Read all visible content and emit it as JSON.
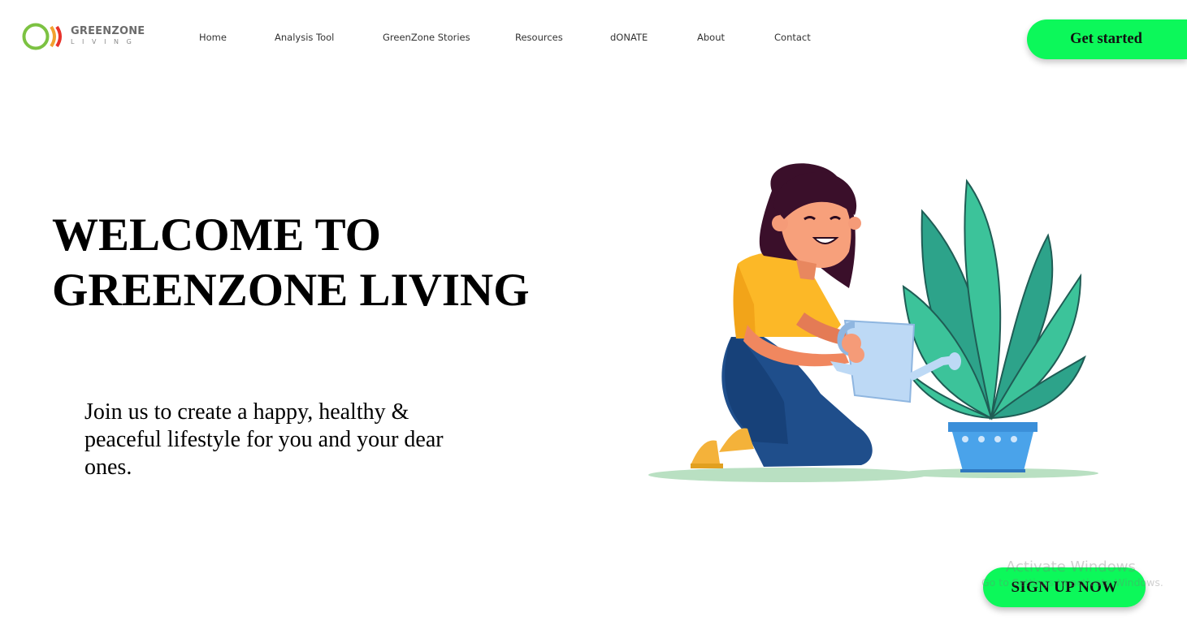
{
  "brand": {
    "name": "GREENZONE",
    "tagline": "LIVING",
    "colors": {
      "ring": "#7cc242",
      "arc_red": "#e8322b",
      "arc_orange": "#f2a12e"
    }
  },
  "nav": {
    "items": [
      {
        "label": "Home"
      },
      {
        "label": "Analysis Tool"
      },
      {
        "label": "GreenZone Stories"
      },
      {
        "label": "Resources"
      },
      {
        "label": "dONATE"
      },
      {
        "label": "About"
      },
      {
        "label": "Contact"
      }
    ]
  },
  "header": {
    "cta_label": "Get started"
  },
  "hero": {
    "title_line1": "WELCOME TO",
    "title_line2": "GREENZONE LIVING",
    "description": "Join us to create a happy, healthy & peaceful lifestyle for you and your dear ones.",
    "illustration_icon": "woman-watering-plant-illustration"
  },
  "footer_cta": {
    "label": "SIGN UP NOW"
  },
  "system_overlay": {
    "title": "Activate Windows",
    "subtitle": "Go to Settings to activate Windows."
  },
  "theme": {
    "accent": "#0cf85a",
    "text": "#000000"
  }
}
